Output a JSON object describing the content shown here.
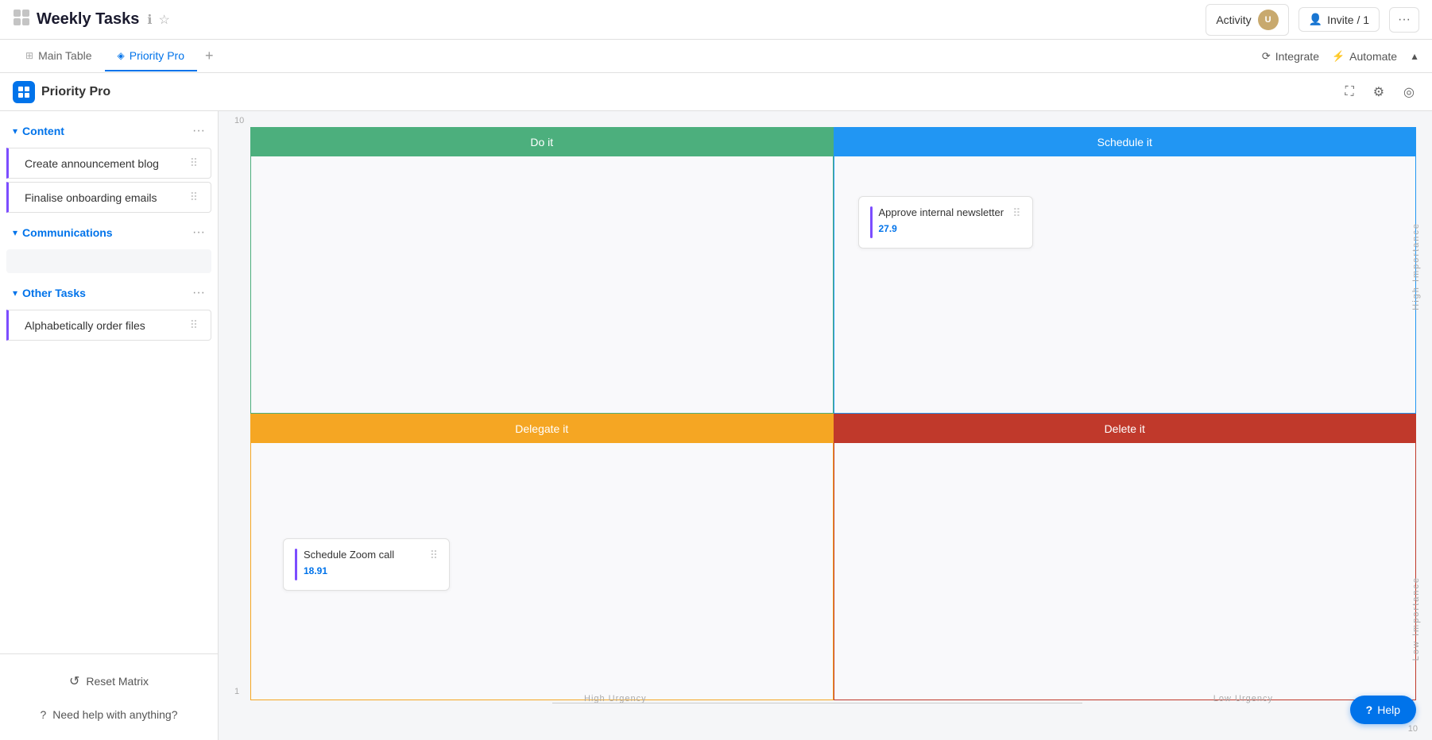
{
  "app": {
    "title": "Weekly Tasks",
    "tabs": [
      {
        "label": "Main Table",
        "active": false
      },
      {
        "label": "Priority Pro",
        "active": true
      }
    ]
  },
  "header": {
    "activity": "Activity",
    "invite": "Invite / 1",
    "integrate": "Integrate",
    "automate": "Automate",
    "view_title": "Priority Pro"
  },
  "sidebar": {
    "sections": [
      {
        "name": "Content",
        "items": [
          {
            "label": "Create announcement blog"
          },
          {
            "label": "Finalise onboarding emails"
          }
        ]
      },
      {
        "name": "Communications",
        "items": []
      },
      {
        "name": "Other Tasks",
        "items": [
          {
            "label": "Alphabetically order files"
          }
        ]
      }
    ],
    "reset_label": "Reset Matrix",
    "help_label": "Need help with anything?"
  },
  "matrix": {
    "quadrants": [
      {
        "id": "do-it",
        "label": "Do it",
        "color": "#4caf7d"
      },
      {
        "id": "schedule-it",
        "label": "Schedule it",
        "color": "#2196f3"
      },
      {
        "id": "delegate-it",
        "label": "Delegate it",
        "color": "#f5a623"
      },
      {
        "id": "delete-it",
        "label": "Delete it",
        "color": "#c0392b"
      }
    ],
    "cards": [
      {
        "id": "approve-newsletter",
        "title": "Approve internal newsletter",
        "value": "27.9",
        "quadrant": "schedule-it"
      },
      {
        "id": "schedule-zoom",
        "title": "Schedule Zoom call",
        "value": "18.91",
        "quadrant": "delegate-it"
      }
    ],
    "x_axis_high": "High Urgency",
    "x_axis_low": "Low Urgency",
    "y_axis_high": "High Importance",
    "y_axis_low": "Low Importance",
    "grid_num_top": "10",
    "grid_num_bottom_left": "1",
    "grid_num_bottom_right": "10"
  },
  "help_button": "Help"
}
